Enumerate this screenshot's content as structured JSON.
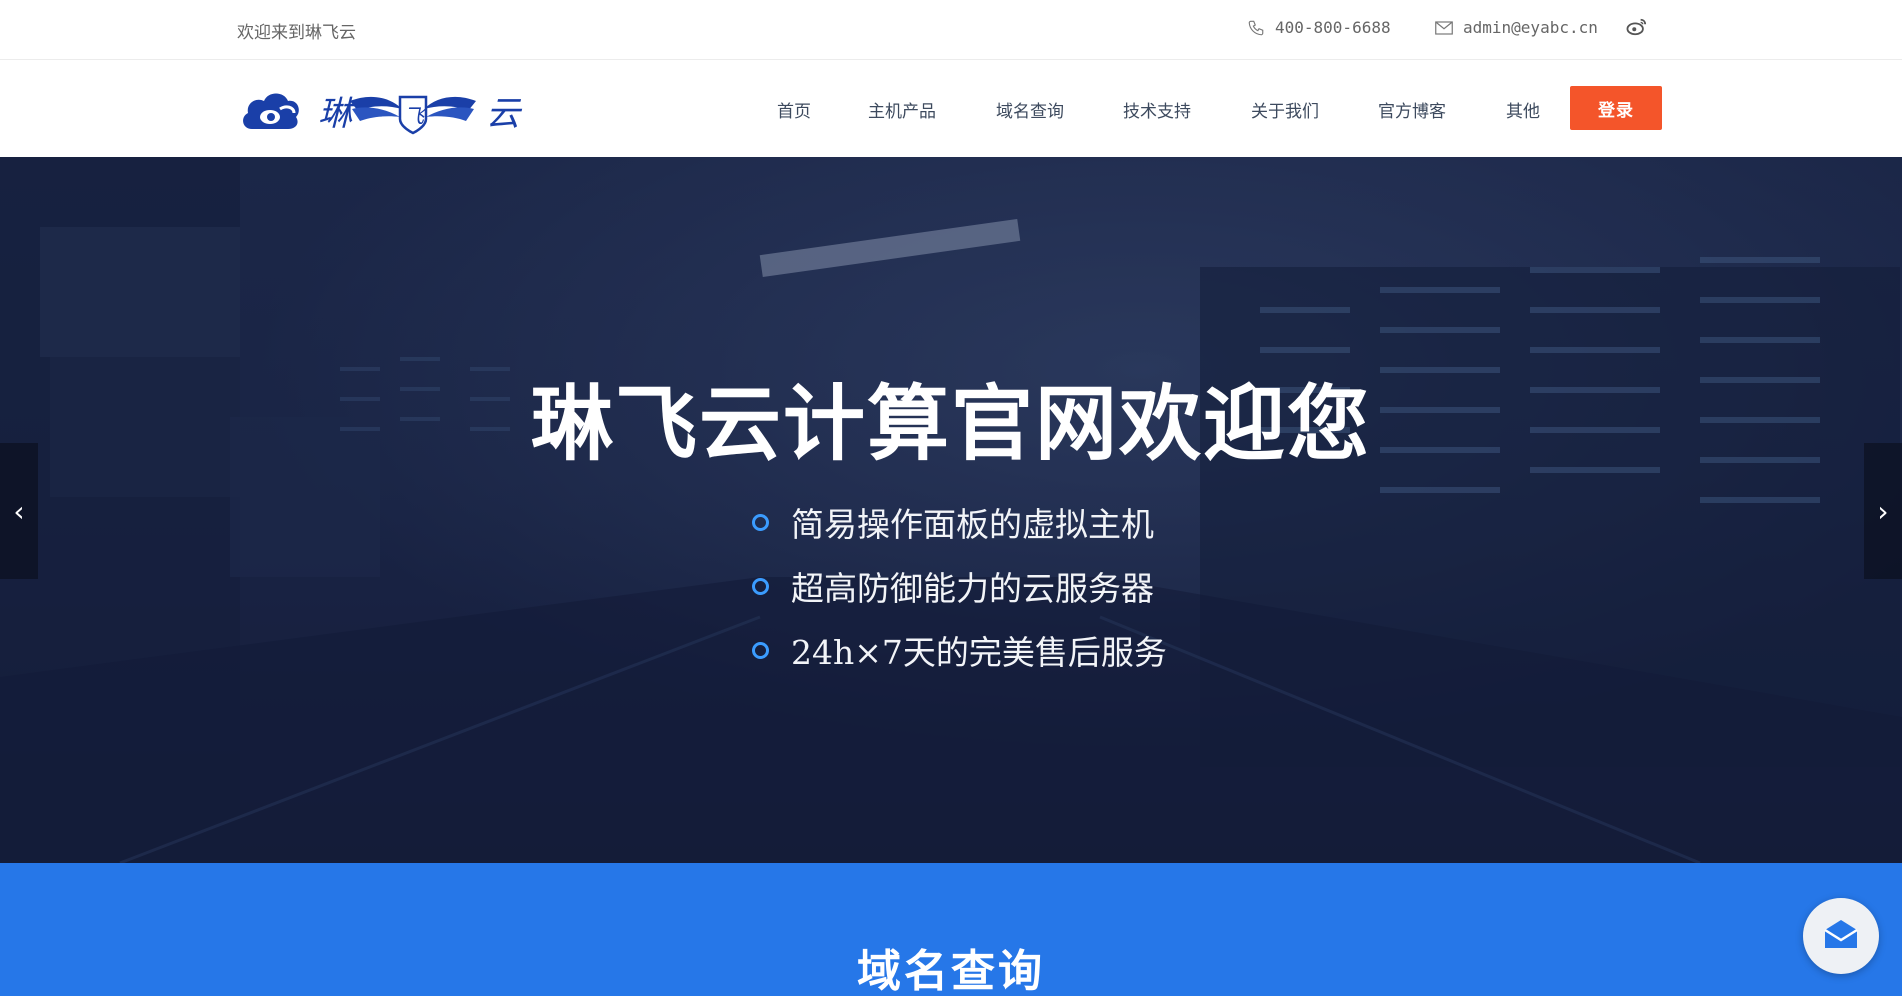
{
  "topbar": {
    "welcome": "欢迎来到琳飞云",
    "phone": "400-800-6688",
    "email": "admin@eyabc.cn",
    "icons": {
      "phone": "phone-icon",
      "email": "mail-icon",
      "social": "weibo-icon"
    }
  },
  "header": {
    "logo_text": "琳飞云",
    "nav": [
      {
        "label": "首页"
      },
      {
        "label": "主机产品"
      },
      {
        "label": "域名查询"
      },
      {
        "label": "技术支持"
      },
      {
        "label": "关于我们"
      },
      {
        "label": "官方博客"
      },
      {
        "label": "其他"
      }
    ],
    "login_label": "登录"
  },
  "hero": {
    "title": "琳飞云计算官网欢迎您",
    "features": [
      "简易操作面板的虚拟主机",
      "超高防御能力的云服务器",
      "24h×7天的完美售后服务"
    ],
    "prev_arrow": "‹",
    "next_arrow": "›"
  },
  "domain_section": {
    "title": "域名查询"
  },
  "colors": {
    "accent_login": "#f4552a",
    "section_blue": "#2677e8",
    "bullet": "#3b9cff",
    "hero_dark": "#1a2444"
  }
}
